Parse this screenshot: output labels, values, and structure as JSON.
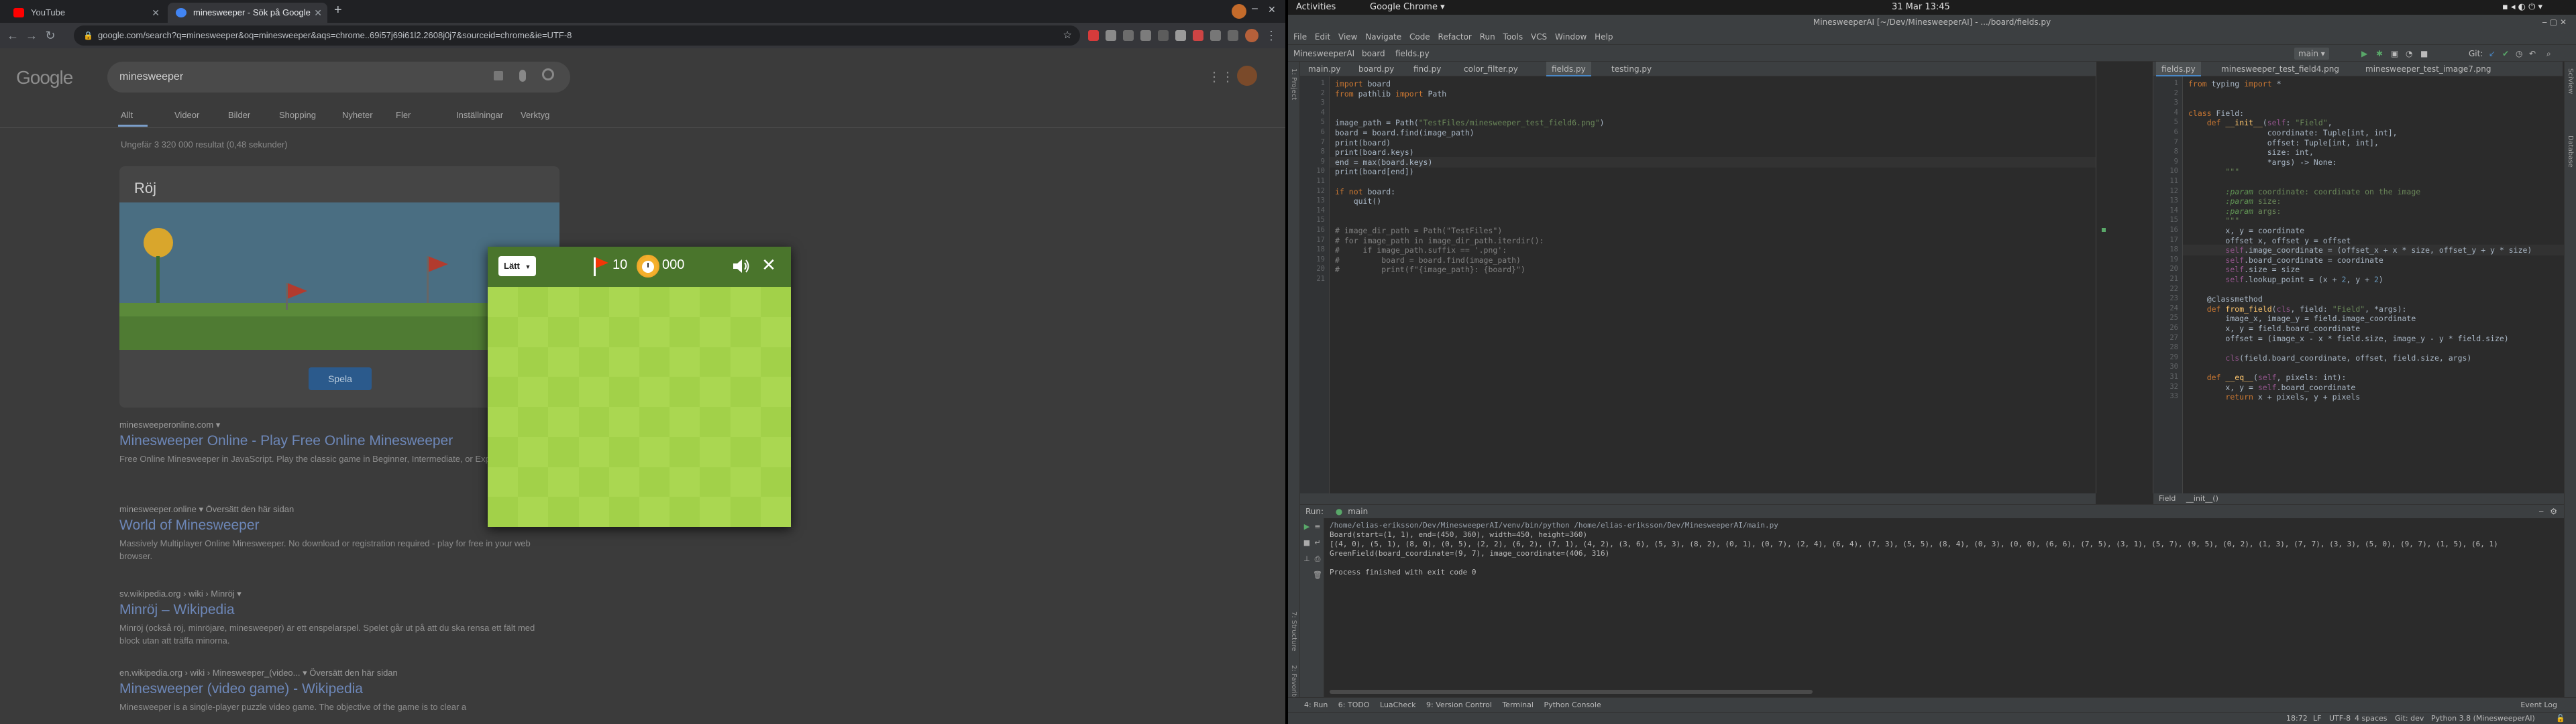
{
  "browser": {
    "tabs": [
      {
        "title": "YouTube",
        "favicon_color": "#ff0000",
        "active": false
      },
      {
        "title": "minesweeper - Sök på Google",
        "favicon_color": "#4285f4",
        "active": true
      }
    ],
    "new_tab": "+",
    "url": "google.com/search?q=minesweeper&oq=minesweeper&aqs=chrome..69i57j69i61l2.2608j0j7&sourceid=chrome&ie=UTF-8"
  },
  "google": {
    "logo": "Google",
    "query": "minesweeper",
    "nav": [
      "Allt",
      "Videor",
      "Bilder",
      "Shopping",
      "Nyheter",
      "Fler",
      "Inställningar",
      "Verktyg"
    ],
    "result_count": "Ungefär 3 320 000 resultat (0,48 sekunder)",
    "card_title": "Röj",
    "play_label": "Spela",
    "results": [
      {
        "url": "minesweeperonline.com ▾",
        "title": "Minesweeper Online - Play Free Online Minesweeper",
        "snippet": "Free Online Minesweeper in JavaScript. Play the classic game in Beginner, Intermediate, or Expert modes ..."
      },
      {
        "url": "minesweeper.online ▾ Översätt den här sidan",
        "title": "World of Minesweeper",
        "snippet": "Massively Multiplayer Online Minesweeper. No download or registration required - play for free in your web browser."
      },
      {
        "url": "sv.wikipedia.org › wiki › Minröj ▾",
        "title": "Minröj – Wikipedia",
        "snippet": "Minröj (också röj, minröjare, minesweeper) är ett enspelarspel. Spelet går ut på att du ska rensa ett fält med block utan att träffa minorna."
      },
      {
        "url": "en.wikipedia.org › wiki › Minesweeper_(video... ▾ Översätt den här sidan",
        "title": "Minesweeper (video game) - Wikipedia",
        "snippet": "Minesweeper is a single-player puzzle video game. The objective of the game is to clear a"
      }
    ]
  },
  "minesweeper": {
    "level": "Lätt",
    "flags": "10",
    "time": "000",
    "grid_light": "#aad751",
    "grid_dark": "#a2d149",
    "bar_color": "#4a752c"
  },
  "ubuntu": {
    "activities": "Activities",
    "app": "Google Chrome ▾",
    "clock": "31 Mar  13:45"
  },
  "ide": {
    "title": "MinesweeperAI [~/Dev/MinesweeperAI] - .../board/fields.py",
    "menu": [
      "File",
      "Edit",
      "View",
      "Navigate",
      "Code",
      "Refactor",
      "Run",
      "Tools",
      "VCS",
      "Window",
      "Help"
    ],
    "breadcrumb": [
      "MinesweeperAI",
      "board",
      "fields.py"
    ],
    "run_config": "main ▾",
    "git_label": "Git:",
    "left_tabs": [
      "main.py",
      "board.py",
      "find.py",
      "color_filter.py",
      "fields.py",
      "testing.py"
    ],
    "right_tabs": [
      "fields.py",
      "minesweeper_test_field4.png",
      "minesweeper_test_image7.png"
    ],
    "left_code": [
      "import board",
      "from pathlib import Path",
      "",
      "",
      "image_path = Path(\"TestFiles/minesweeper_test_field6.png\")",
      "board = board.find(image_path)",
      "print(board)",
      "print(board.keys)",
      "end = max(board.keys)",
      "print(board[end])",
      "",
      "if not board:",
      "    quit()",
      "",
      "",
      "# image_dir_path = Path(\"TestFiles\")",
      "# for image_path in image_dir_path.iterdir():",
      "#     if image_path.suffix == '.png':",
      "#         board = board.find(image_path)",
      "#         print(f\"{image_path}: {board}\")",
      ""
    ],
    "right_code": [
      "from typing import *",
      "",
      "",
      "class Field:",
      "    def __init__(self: \"Field\",",
      "                 coordinate: Tuple[int, int],",
      "                 offset: Tuple[int, int],",
      "                 size: int,",
      "                 *args) -> None:",
      "        \"\"\"",
      "",
      "        :param coordinate: coordinate on the image",
      "        :param size:",
      "        :param args:",
      "        \"\"\"",
      "        x, y = coordinate",
      "        offset_x, offset_y = offset",
      "        self.image_coordinate = (offset_x + x * size, offset_y + y * size)",
      "        self.board_coordinate = coordinate",
      "        self.size = size",
      "        self.lookup_point = (x + 2, y + 2)",
      "",
      "    @classmethod",
      "    def from_field(cls, field: \"Field\", *args):",
      "        image_x, image_y = field.image_coordinate",
      "        x, y = field.board_coordinate",
      "        offset = (image_x - x * field.size, image_y - y * field.size)",
      "",
      "        cls(field.board_coordinate, offset, field.size, args)",
      "",
      "    def __eq__(self, pixels: int):",
      "        x, y = self.board_coordinate",
      "        return x + pixels, y + pixels"
    ],
    "right_footer": [
      "Field",
      "__init__()"
    ],
    "run": {
      "header": "Run:",
      "config": "main",
      "output": [
        "/home/elias-eriksson/Dev/MinesweeperAI/venv/bin/python /home/elias-eriksson/Dev/MinesweeperAI/main.py",
        "Board(start=(1, 1), end=(450, 360), width=450, height=360)",
        "[(4, 0), (5, 1), (8, 0), (0, 5), (2, 2), (6, 2), (7, 1), (4, 2), (3, 6), (5, 3), (8, 2), (0, 1), (0, 7), (2, 4), (6, 4), (7, 3), (5, 5), (8, 4), (0, 3), (0, 0), (6, 6), (7, 5), (3, 1), (5, 7), (9, 5), (0, 2), (1, 3), (7, 7), (3, 3), (5, 0), (9, 7), (1, 5), (6, 1)",
        "GreenField(board_coordinate=(9, 7), image_coordinate=(406, 316)",
        "",
        "Process finished with exit code 0"
      ]
    },
    "bottom_tools": [
      "4: Run",
      "6: TODO",
      "LuaCheck",
      "9: Version Control",
      "Terminal",
      "Python Console"
    ],
    "event_log": "Event Log",
    "status": [
      "18:72",
      "LF",
      "UTF-8",
      "4 spaces",
      "Git: dev",
      "Python 3.8 (MinesweeperAI)"
    ]
  }
}
